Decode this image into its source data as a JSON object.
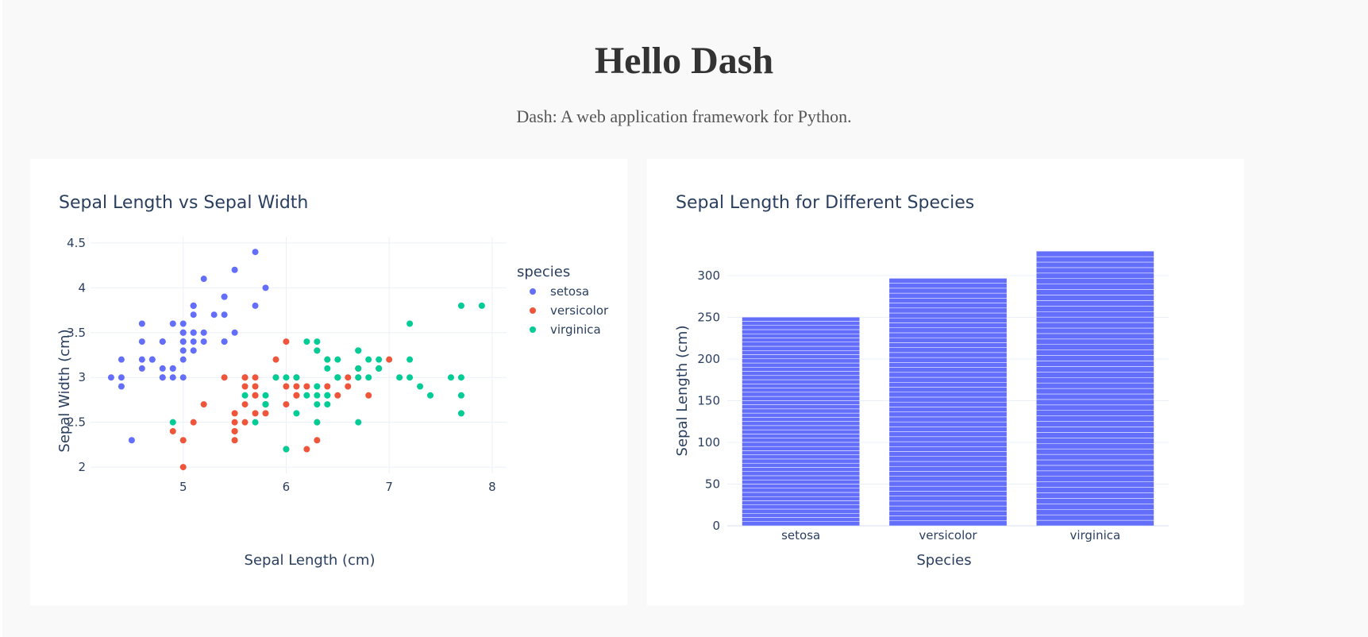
{
  "header": {
    "title": "Hello Dash",
    "subtitle": "Dash: A web application framework for Python."
  },
  "colors": {
    "setosa": "#636efa",
    "versicolor": "#EF553B",
    "virginica": "#00cc96",
    "bar": "#636efa",
    "text": "#2a3f5f"
  },
  "chart_data": [
    {
      "type": "scatter",
      "title": "Sepal Length vs Sepal Width",
      "xlabel": "Sepal Length (cm)",
      "ylabel": "Sepal Width (cm)",
      "xlim": [
        4.1,
        8.14
      ],
      "ylim": [
        1.93,
        4.57
      ],
      "xticks": [
        5,
        6,
        7,
        8
      ],
      "yticks": [
        2,
        2.5,
        3,
        3.5,
        4,
        4.5
      ],
      "ytick_labels": [
        "2",
        "2.5",
        "3",
        "3.5",
        "4",
        "4.5"
      ],
      "legend_title": "species",
      "legend_position": "top-right",
      "grid": true,
      "series": [
        {
          "name": "setosa",
          "x": [
            5.1,
            4.9,
            4.7,
            4.6,
            5.0,
            5.4,
            4.6,
            5.0,
            4.4,
            4.9,
            5.4,
            4.8,
            4.8,
            4.3,
            5.8,
            5.7,
            5.4,
            5.1,
            5.7,
            5.1,
            5.4,
            5.1,
            4.6,
            5.1,
            4.8,
            5.0,
            5.0,
            5.2,
            5.2,
            4.7,
            4.8,
            5.4,
            5.2,
            5.5,
            4.9,
            5.0,
            5.5,
            4.9,
            4.4,
            5.1,
            5.0,
            4.5,
            4.4,
            5.0,
            5.1,
            4.8,
            5.1,
            4.6,
            5.3,
            5.0
          ],
          "y": [
            3.5,
            3.0,
            3.2,
            3.1,
            3.6,
            3.9,
            3.4,
            3.4,
            2.9,
            3.1,
            3.7,
            3.4,
            3.0,
            3.0,
            4.0,
            4.4,
            3.9,
            3.5,
            3.8,
            3.8,
            3.4,
            3.7,
            3.6,
            3.3,
            3.4,
            3.0,
            3.4,
            3.5,
            3.4,
            3.2,
            3.1,
            3.4,
            4.1,
            4.2,
            3.1,
            3.2,
            3.5,
            3.6,
            3.0,
            3.4,
            3.5,
            2.3,
            3.2,
            3.5,
            3.8,
            3.0,
            3.8,
            3.2,
            3.7,
            3.3
          ]
        },
        {
          "name": "versicolor",
          "x": [
            7.0,
            6.4,
            6.9,
            5.5,
            6.5,
            5.7,
            6.3,
            4.9,
            6.6,
            5.2,
            5.0,
            5.9,
            6.0,
            6.1,
            5.6,
            6.7,
            5.6,
            5.8,
            6.2,
            5.6,
            5.9,
            6.1,
            6.3,
            6.1,
            6.4,
            6.6,
            6.8,
            6.7,
            6.0,
            5.7,
            5.5,
            5.5,
            5.8,
            6.0,
            5.4,
            6.0,
            6.7,
            6.3,
            5.6,
            5.5,
            5.5,
            6.1,
            5.8,
            5.0,
            5.6,
            5.7,
            5.7,
            6.2,
            5.1,
            5.7
          ],
          "y": [
            3.2,
            3.2,
            3.1,
            2.3,
            2.8,
            2.8,
            3.3,
            2.4,
            2.9,
            2.7,
            2.0,
            3.0,
            2.2,
            2.9,
            2.9,
            3.1,
            3.0,
            2.7,
            2.2,
            2.5,
            3.2,
            2.8,
            2.5,
            2.8,
            2.9,
            3.0,
            2.8,
            3.0,
            2.9,
            2.6,
            2.4,
            2.4,
            2.7,
            2.7,
            3.0,
            3.4,
            3.1,
            2.3,
            3.0,
            2.5,
            2.6,
            3.0,
            2.6,
            2.3,
            2.7,
            3.0,
            2.9,
            2.9,
            2.5,
            2.8
          ]
        },
        {
          "name": "virginica",
          "x": [
            6.3,
            5.8,
            7.1,
            6.3,
            6.5,
            7.6,
            4.9,
            7.3,
            6.7,
            7.2,
            6.5,
            6.4,
            6.8,
            5.7,
            5.8,
            6.4,
            6.5,
            7.7,
            7.7,
            6.0,
            6.9,
            5.6,
            7.7,
            6.3,
            6.7,
            7.2,
            6.2,
            6.1,
            6.4,
            7.2,
            7.4,
            7.9,
            6.4,
            6.3,
            6.1,
            7.7,
            6.3,
            6.4,
            6.0,
            6.9,
            6.7,
            6.9,
            5.8,
            6.8,
            6.7,
            6.7,
            6.3,
            6.5,
            6.2,
            5.9
          ],
          "y": [
            3.3,
            2.7,
            3.0,
            2.9,
            3.0,
            3.0,
            2.5,
            2.9,
            2.5,
            3.6,
            3.2,
            2.7,
            3.0,
            2.5,
            2.8,
            3.2,
            3.0,
            3.8,
            2.6,
            2.2,
            3.2,
            2.8,
            2.8,
            2.7,
            3.3,
            3.2,
            2.8,
            3.0,
            2.8,
            3.0,
            2.8,
            3.8,
            2.8,
            2.8,
            2.6,
            3.0,
            3.4,
            3.1,
            3.0,
            3.1,
            3.1,
            3.1,
            2.7,
            3.2,
            3.3,
            3.0,
            2.5,
            3.0,
            3.4,
            3.0
          ]
        }
      ]
    },
    {
      "type": "bar",
      "title": "Sepal Length for Different Species",
      "xlabel": "Species",
      "ylabel": "Sepal Length (cm)",
      "categories": [
        "setosa",
        "versicolor",
        "virginica"
      ],
      "values": [
        250.3,
        296.8,
        329.4
      ],
      "ylim": [
        0,
        346.7
      ],
      "yticks": [
        0,
        50,
        100,
        150,
        200,
        250,
        300
      ],
      "stacked_segments_per_bar": 50,
      "grid": true
    }
  ]
}
